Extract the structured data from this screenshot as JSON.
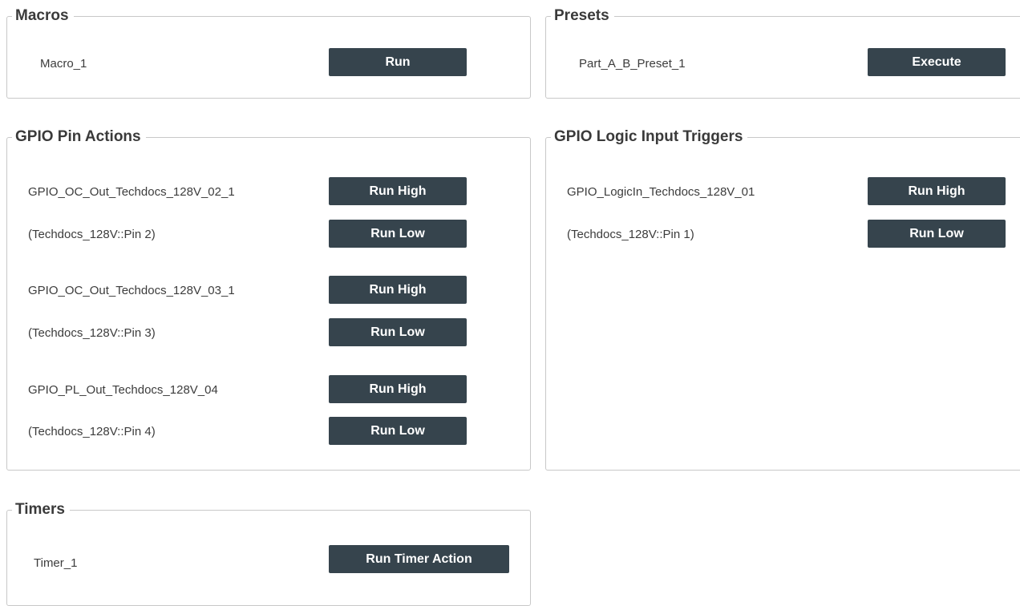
{
  "macros": {
    "title": "Macros",
    "items": [
      {
        "name": "Macro_1",
        "button": "Run"
      }
    ]
  },
  "presets": {
    "title": "Presets",
    "items": [
      {
        "name": "Part_A_B_Preset_1",
        "button": "Execute"
      }
    ]
  },
  "gpio_pin_actions": {
    "title": "GPIO Pin Actions",
    "items": [
      {
        "name": "GPIO_OC_Out_Techdocs_128V_02_1",
        "pin": "(Techdocs_128V::Pin 2)",
        "high_button": "Run High",
        "low_button": "Run Low"
      },
      {
        "name": "GPIO_OC_Out_Techdocs_128V_03_1",
        "pin": "(Techdocs_128V::Pin 3)",
        "high_button": "Run High",
        "low_button": "Run Low"
      },
      {
        "name": "GPIO_PL_Out_Techdocs_128V_04",
        "pin": "(Techdocs_128V::Pin 4)",
        "high_button": "Run High",
        "low_button": "Run Low"
      }
    ]
  },
  "gpio_logic_input_triggers": {
    "title": "GPIO Logic Input Triggers",
    "items": [
      {
        "name": "GPIO_LogicIn_Techdocs_128V_01",
        "pin": "(Techdocs_128V::Pin 1)",
        "high_button": "Run High",
        "low_button": "Run Low"
      }
    ]
  },
  "timers": {
    "title": "Timers",
    "items": [
      {
        "name": "Timer_1",
        "button": "Run Timer Action"
      }
    ]
  },
  "colors": {
    "button_bg": "#36444d",
    "button_text": "#ffffff",
    "border": "#c8c8c8"
  }
}
